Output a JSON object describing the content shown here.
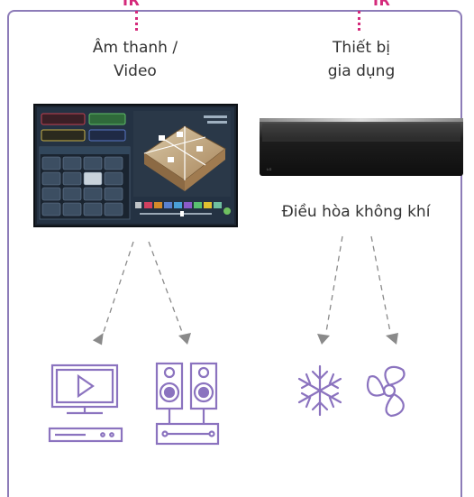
{
  "ir_left": "IR",
  "ir_right": "IR",
  "av_label": "Âm thanh /\nVideo",
  "appliance_label": "Thiết bị\ngia dụng",
  "ac_label": "Điều hòa không khí",
  "colors": {
    "frame": "#8d7cb8",
    "ir": "#d42a7b",
    "icon": "#8b73bf",
    "arrow": "#8a8a8a"
  },
  "icons": [
    "tv-video-player-icon",
    "speakers-amplifier-icon",
    "snowflake-icon",
    "fan-icon"
  ]
}
